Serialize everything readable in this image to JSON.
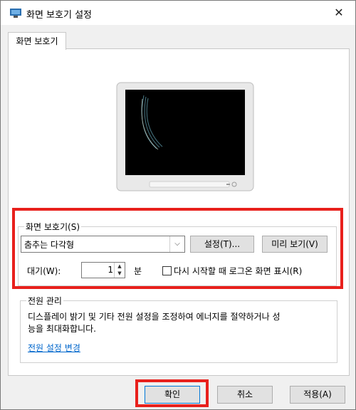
{
  "window": {
    "title": "화면 보호기 설정",
    "close_glyph": "✕"
  },
  "tab": {
    "label": "화면 보호기"
  },
  "screensaver": {
    "group_label": "화면 보호기(S)",
    "selected": "춤추는 다각형",
    "settings_button": "설정(T)...",
    "preview_button": "미리 보기(V)",
    "wait_label": "대기(W):",
    "wait_value": "1",
    "wait_unit": "분",
    "logon_checkbox_label": "다시 시작할 때 로그온 화면 표시(R)",
    "logon_checked": false
  },
  "power": {
    "group_label": "전원 관리",
    "description_line1": "디스플레이 밝기 및 기타 전원 설정을 조정하여 에너지를 절약하거나 성",
    "description_line2": "능을 최대화합니다.",
    "link": "전원 설정 변경"
  },
  "footer": {
    "ok": "확인",
    "cancel": "취소",
    "apply": "적용(A)"
  },
  "colors": {
    "highlight": "#e8201c",
    "link": "#0066cc"
  },
  "icons": [
    "screensaver-app-icon",
    "close-icon",
    "chevron-down-icon",
    "spin-up-icon",
    "spin-down-icon"
  ]
}
